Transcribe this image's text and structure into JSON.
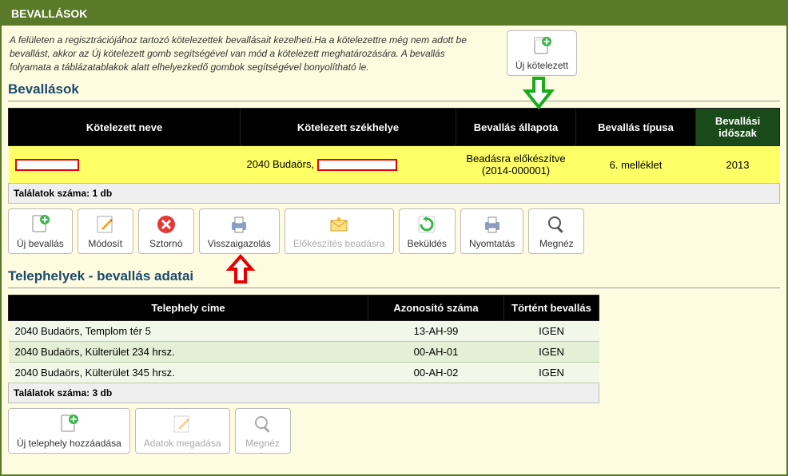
{
  "header": {
    "title": "BEVALLÁSOK"
  },
  "description": "A felületen a regisztrációjához tartozó kötelezettek bevallásait kezelheti.Ha a kötelezettre még nem adott be bevallást, akkor az Új kötelezett gomb segítségével van mód a kötelezett meghatározására. A bevallás folyamata a táblázatablakok alatt elhelyezkedő gombok segítségével bonyolítható le.",
  "new_obligor": {
    "label": "Új kötelezett"
  },
  "returns": {
    "title": "Bevallások",
    "columns": {
      "name": "Kötelezett neve",
      "seat": "Kötelezett székhelye",
      "status": "Bevallás állapota",
      "type": "Bevallás típusa",
      "period": "Bevallási időszak"
    },
    "row": {
      "name_redacted": true,
      "seat_prefix": "2040 Budaörs, ",
      "status_line1": "Beadásra előkészítve",
      "status_line2": "(2014-000001)",
      "type": "6. melléklet",
      "period": "2013"
    },
    "footer": "Találatok száma: 1 db"
  },
  "toolbar": {
    "uj_bevallas": "Új bevallás",
    "modosit": "Módosít",
    "storno": "Sztornó",
    "visszaigazolas": "Visszaigazolás",
    "elokeszites": "Előkészítés beadásra",
    "bekuldes": "Beküldés",
    "nyomtatas": "Nyomtatás",
    "megnez": "Megnéz"
  },
  "sites": {
    "title": "Telephelyek - bevallás adatai",
    "columns": {
      "address": "Telephely címe",
      "id": "Azonosító száma",
      "done": "Történt bevallás"
    },
    "rows": [
      {
        "address": "2040 Budaörs, Templom tér 5",
        "id": "13-AH-99",
        "done": "IGEN"
      },
      {
        "address": "2040 Budaörs, Külterület 234 hrsz.",
        "id": "00-AH-01",
        "done": "IGEN"
      },
      {
        "address": "2040 Budaörs, Külterület 345 hrsz.",
        "id": "00-AH-02",
        "done": "IGEN"
      }
    ],
    "footer": "Találatok száma: 3 db"
  },
  "sites_toolbar": {
    "uj_telephely": "Új telephely hozzáadása",
    "adatok": "Adatok megadása",
    "megnez": "Megnéz"
  }
}
